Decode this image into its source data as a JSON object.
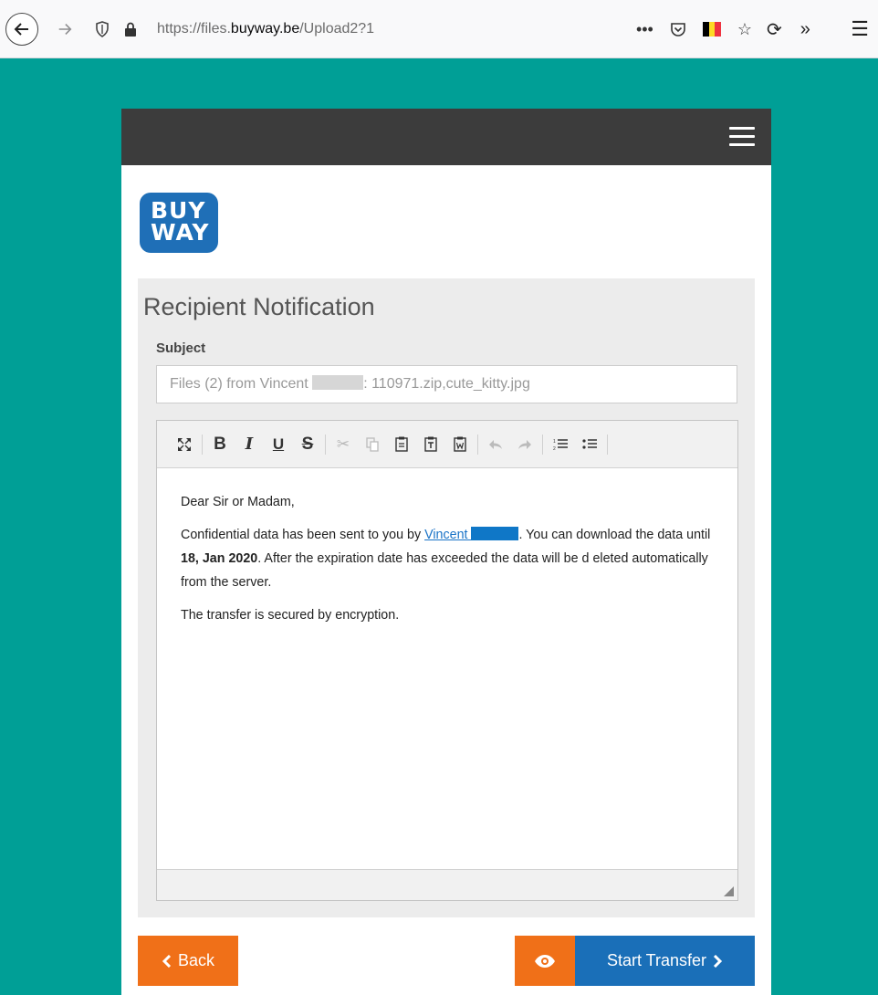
{
  "browser": {
    "url_prefix": "https://files.",
    "url_domain": "buyway.be",
    "url_path": "/Upload2?1"
  },
  "colors": {
    "teal_background": "#009f96",
    "header_bar": "#3c3c3c",
    "brand_blue": "#1f6fb7",
    "orange": "#f07018",
    "primary_blue": "#1a6fb8"
  },
  "logo": {
    "line1": "BUY",
    "line2": "WAY"
  },
  "panel": {
    "title": "Recipient Notification"
  },
  "subject": {
    "label": "Subject",
    "value_prefix": "Files (2) from Vincent",
    "value_suffix": ": 110971.zip,cute_kitty.jpg"
  },
  "toolbar": {
    "icons": [
      "maximize-icon",
      "bold-icon",
      "italic-icon",
      "underline-icon",
      "strikethrough-icon",
      "cut-icon",
      "copy-icon",
      "paste-icon",
      "paste-text-icon",
      "paste-word-icon",
      "undo-icon",
      "redo-icon",
      "numbered-list-icon",
      "bulleted-list-icon"
    ],
    "bold": "B",
    "italic": "I",
    "underline": "U",
    "strike": "S"
  },
  "message": {
    "greeting": "Dear Sir or Madam,",
    "p1_before_link": "Confidential data has been sent to you by ",
    "link_text": "Vincent",
    "p1_after_link": ". You can download the data until ",
    "expiry_date": "18, Jan 2020",
    "p1_end": ". After the expiration date has exceeded the data will be d eleted automatically from the server.",
    "p2": "The transfer is secured by encryption."
  },
  "buttons": {
    "back": "Back",
    "start": "Start Transfer"
  }
}
